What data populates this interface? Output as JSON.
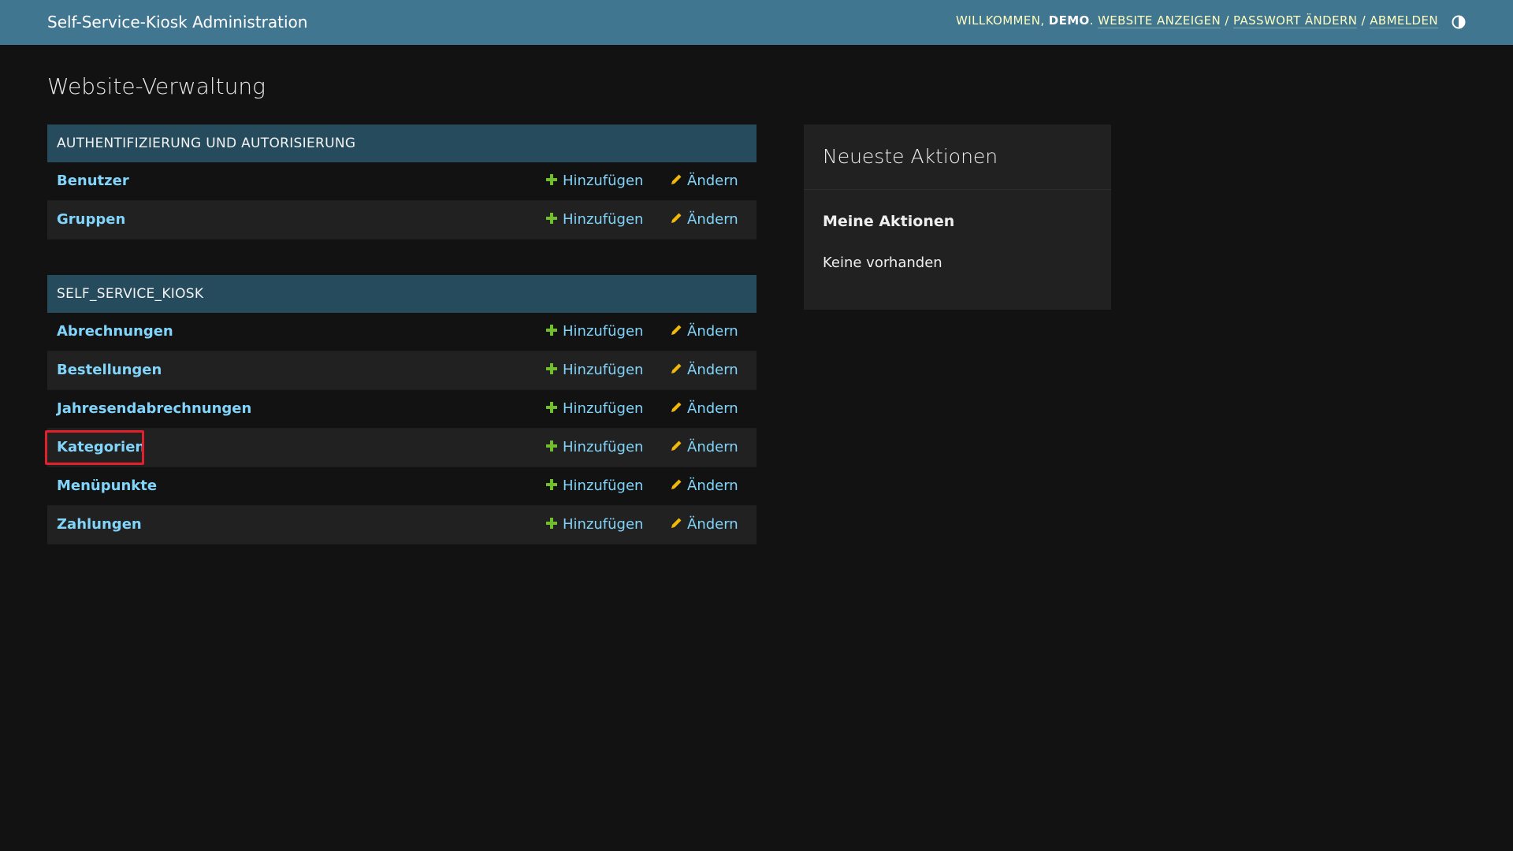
{
  "header": {
    "title": "Self-Service-Kiosk Administration",
    "welcome": "Willkommen,",
    "username": "demo",
    "view_site": "Website anzeigen",
    "change_password": "Passwort ändern",
    "logout": "Abmelden",
    "separator": "/",
    "theme_icon": "contrast-toggle-icon"
  },
  "page": {
    "title": "Website-Verwaltung"
  },
  "modules": [
    {
      "caption": "Authentifizierung und Autorisierung",
      "models": [
        {
          "name": "Benutzer",
          "add": "Hinzufügen",
          "change": "Ändern"
        },
        {
          "name": "Gruppen",
          "add": "Hinzufügen",
          "change": "Ändern"
        }
      ]
    },
    {
      "caption": "SELF_SERVICE_KIOSK",
      "models": [
        {
          "name": "Abrechnungen",
          "add": "Hinzufügen",
          "change": "Ändern"
        },
        {
          "name": "Bestellungen",
          "add": "Hinzufügen",
          "change": "Ändern"
        },
        {
          "name": "Jahresendabrechnungen",
          "add": "Hinzufügen",
          "change": "Ändern"
        },
        {
          "name": "Kategorien",
          "add": "Hinzufügen",
          "change": "Ändern"
        },
        {
          "name": "Menüpunkte",
          "add": "Hinzufügen",
          "change": "Ändern"
        },
        {
          "name": "Zahlungen",
          "add": "Hinzufügen",
          "change": "Ändern"
        }
      ]
    }
  ],
  "recent_actions": {
    "title": "Neueste Aktionen",
    "my_actions": "Meine Aktionen",
    "empty": "Keine vorhanden"
  },
  "colors": {
    "header_bg": "#417690",
    "module_caption_bg": "#264b5d",
    "link": "#81d4fa",
    "add_icon": "#70bf2b",
    "change_icon": "#efb80b",
    "highlight": "#e0202a"
  }
}
